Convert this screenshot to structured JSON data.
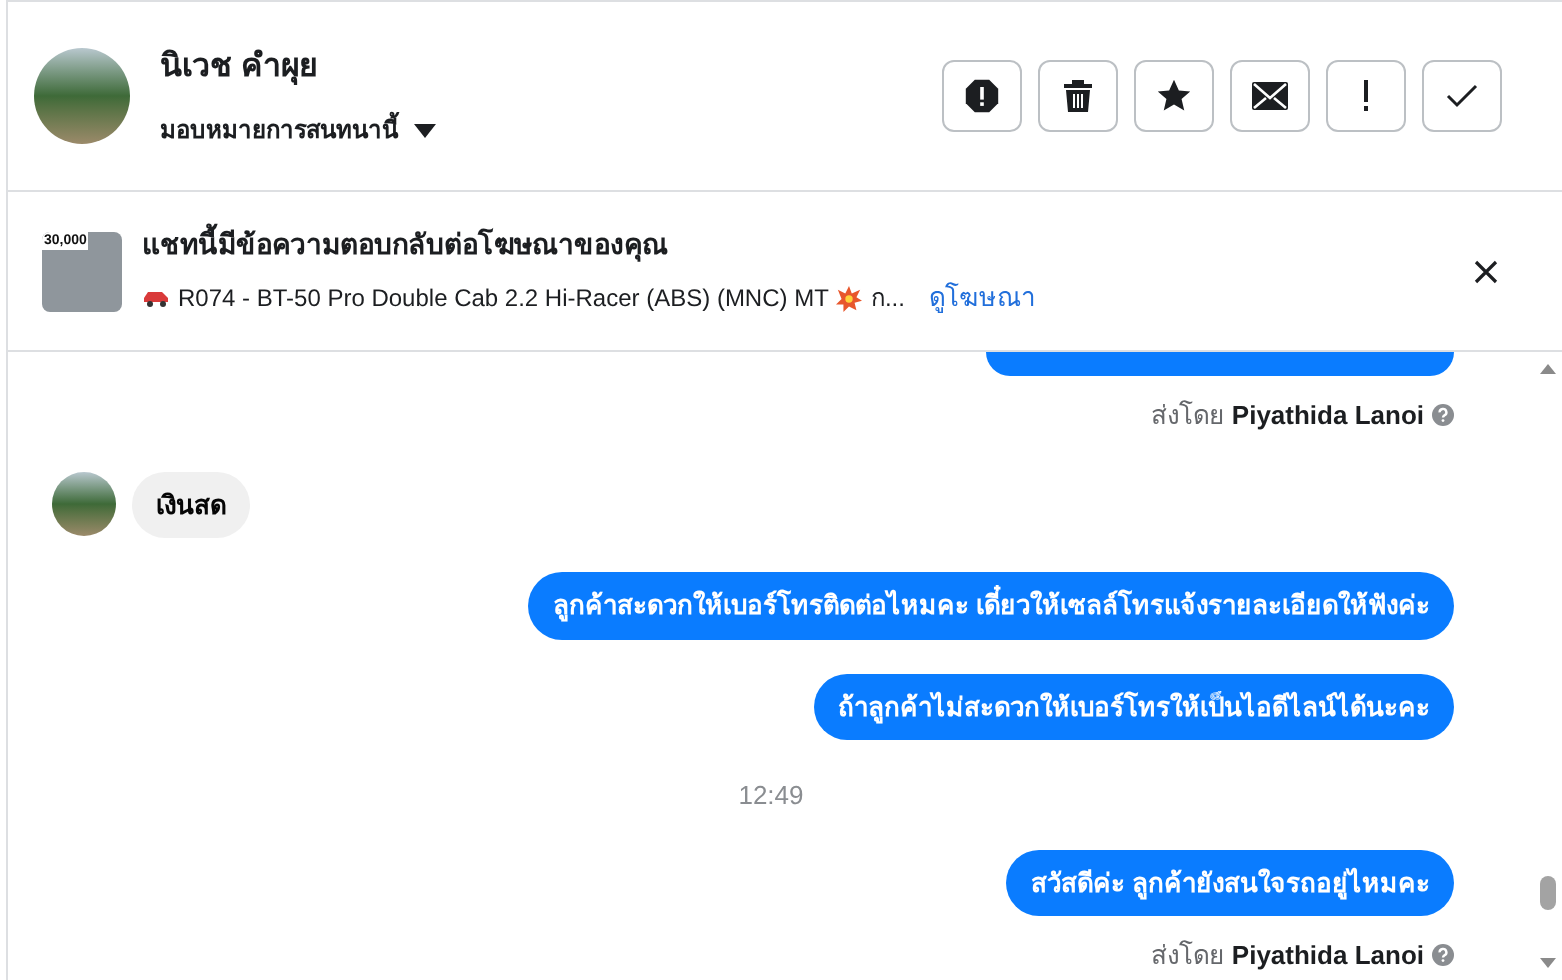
{
  "contact": {
    "name": "นิเวช คำผุย",
    "assign_label": "มอบหมายการสนทนานี้"
  },
  "ad_banner": {
    "title": "แชทนี้มีข้อความตอบกลับต่อโฆษณาของคุณ",
    "ad_text": "R074 - BT-50 Pro Double Cab 2.2 Hi-Racer (ABS) (MNC) MT",
    "ad_tail": "ก...",
    "link": "ดูโฆษณา",
    "thumbnail_price": "30,000"
  },
  "messages": [
    {
      "kind": "clipped_outgoing"
    },
    {
      "kind": "sender",
      "prefix": "ส่งโดย",
      "name": "Piyathida Lanoi"
    },
    {
      "kind": "incoming",
      "text": "เงินสด"
    },
    {
      "kind": "outgoing",
      "text": "ลูกค้าสะดวกให้เบอร์โทรติดต่อไหมคะ เดี๋ยวให้เซลล์โทรแจ้งรายละเอียดให้ฟังค่ะ"
    },
    {
      "kind": "outgoing",
      "text": "ถ้าลูกค้าไม่สะดวกให้เบอร์โทรให้เป็นไอดีไลน์ได้นะคะ"
    },
    {
      "kind": "time",
      "text": "12:49"
    },
    {
      "kind": "outgoing",
      "text": "สวัสดีค่ะ ลูกค้ายังสนใจรถอยู่ไหมคะ"
    },
    {
      "kind": "sender",
      "prefix": "ส่งโดย",
      "name": "Piyathida Lanoi"
    }
  ]
}
